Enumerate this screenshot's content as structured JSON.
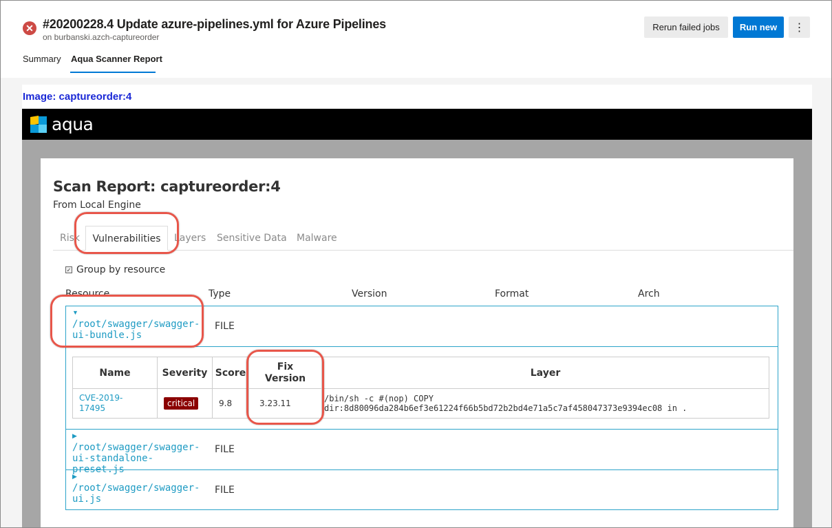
{
  "header": {
    "title": "#20200228.4 Update azure-pipelines.yml for Azure Pipelines",
    "subtitle": "on burbanski.azch-captureorder",
    "status_icon": "error-x-icon",
    "rerun_label": "Rerun failed jobs",
    "run_new_label": "Run new",
    "more_icon": "⋮"
  },
  "tabs": {
    "summary": "Summary",
    "aqua": "Aqua Scanner Report"
  },
  "report": {
    "image_title": "Image: captureorder:4",
    "brand": "aqua",
    "scan_title": "Scan Report: captureorder:4",
    "scan_subtitle": "From Local Engine",
    "inner_tabs": {
      "risk": "Risk",
      "vulnerabilities": "Vulnerabilities",
      "layers": "Layers",
      "sensitive": "Sensitive Data",
      "malware": "Malware"
    },
    "group_by_label": "Group by resource",
    "columns": {
      "resource": "Resource",
      "type": "Type",
      "version": "Version",
      "format": "Format",
      "arch": "Arch"
    },
    "resources": [
      {
        "expander": "▼",
        "path": "/root/swagger/swagger-ui-bundle.js",
        "type": "FILE"
      },
      {
        "expander": "▶",
        "path": "/root/swagger/swagger-ui-standalone-preset.js",
        "type": "FILE"
      },
      {
        "expander": "▶",
        "path": "/root/swagger/swagger-ui.js",
        "type": "FILE"
      }
    ],
    "vuln_table": {
      "headers": {
        "name": "Name",
        "severity": "Severity",
        "score": "Score",
        "fix_version": "Fix Version",
        "layer": "Layer"
      },
      "row": {
        "name": "CVE-2019-17495",
        "severity": "critical",
        "score": "9.8",
        "fix_version": "3.23.11",
        "layer": "/bin/sh -c #(nop) COPY dir:8d80096da284b6ef3e61224f66b5bd72b2bd4e71a5c7af458047373e9394ec08 in ."
      }
    }
  },
  "colors": {
    "accent": "#0078d4",
    "error": "#cd4a45",
    "link": "#1e9bc3",
    "critical": "#8b0000",
    "highlight": "#e8564a"
  }
}
